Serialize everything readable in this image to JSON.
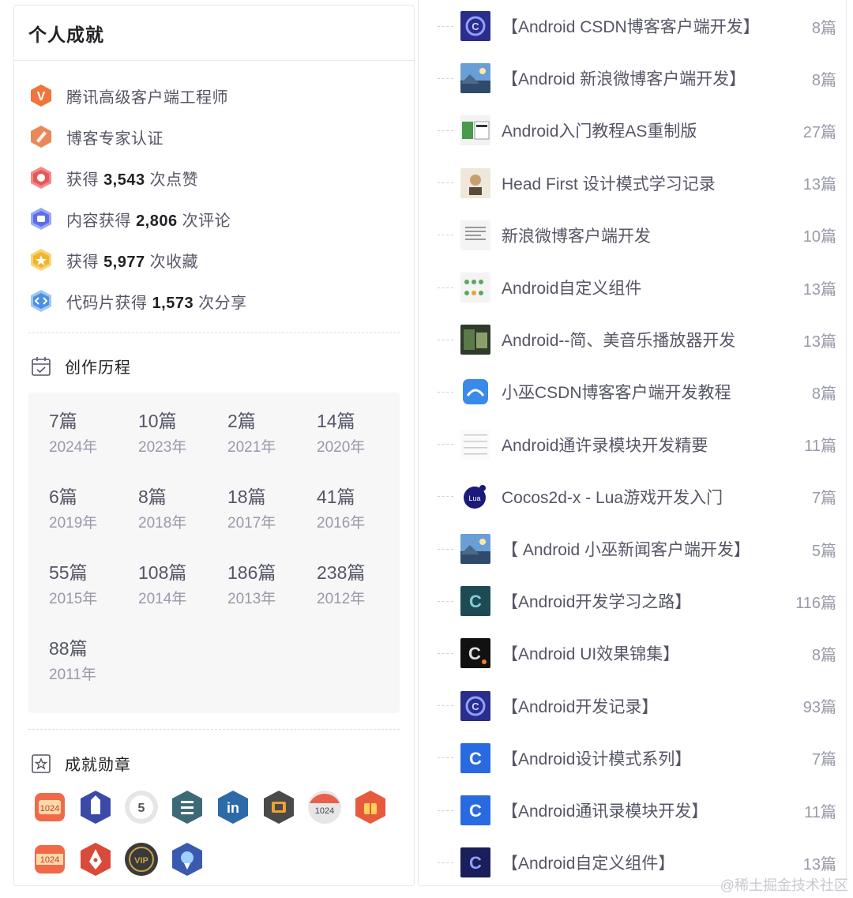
{
  "profile": {
    "title": "个人成就",
    "achievements": [
      {
        "icon": "v-badge-icon",
        "pre": "腾讯高级客户端工程师",
        "num": "",
        "post": ""
      },
      {
        "icon": "expert-badge-icon",
        "pre": "博客专家认证",
        "num": "",
        "post": ""
      },
      {
        "icon": "like-badge-icon",
        "pre": "获得 ",
        "num": "3,543",
        "post": " 次点赞"
      },
      {
        "icon": "comment-badge-icon",
        "pre": "内容获得 ",
        "num": "2,806",
        "post": " 次评论"
      },
      {
        "icon": "favorite-badge-icon",
        "pre": "获得 ",
        "num": "5,977",
        "post": " 次收藏"
      },
      {
        "icon": "code-badge-icon",
        "pre": "代码片获得 ",
        "num": "1,573",
        "post": " 次分享"
      }
    ]
  },
  "history": {
    "title": "创作历程",
    "items": [
      {
        "count": "7篇",
        "year": "2024年"
      },
      {
        "count": "10篇",
        "year": "2023年"
      },
      {
        "count": "2篇",
        "year": "2021年"
      },
      {
        "count": "14篇",
        "year": "2020年"
      },
      {
        "count": "6篇",
        "year": "2019年"
      },
      {
        "count": "8篇",
        "year": "2018年"
      },
      {
        "count": "18篇",
        "year": "2017年"
      },
      {
        "count": "41篇",
        "year": "2016年"
      },
      {
        "count": "55篇",
        "year": "2015年"
      },
      {
        "count": "108篇",
        "year": "2014年"
      },
      {
        "count": "186篇",
        "year": "2013年"
      },
      {
        "count": "238篇",
        "year": "2012年"
      },
      {
        "count": "88篇",
        "year": "2011年"
      }
    ]
  },
  "medals": {
    "title": "成就勋章",
    "items": [
      {
        "icon": "medal-1024-icon",
        "color": "#e8604c"
      },
      {
        "icon": "medal-castle-icon",
        "color": "#3b4aa8"
      },
      {
        "icon": "medal-5-year-icon",
        "color": "#e6e6e6"
      },
      {
        "icon": "medal-list-icon",
        "color": "#3e6a78"
      },
      {
        "icon": "medal-linkedin-icon",
        "color": "#2e6aa8"
      },
      {
        "icon": "medal-bracket-icon",
        "color": "#4a4a4a"
      },
      {
        "icon": "medal-1024-gray-icon",
        "color": "#d8d8d8"
      },
      {
        "icon": "medal-gift-icon",
        "color": "#e85a3c"
      },
      {
        "icon": "medal-1024-ribbon-icon",
        "color": "#e8604c"
      },
      {
        "icon": "medal-pen-icon",
        "color": "#d94a3a"
      },
      {
        "icon": "medal-vip-icon",
        "color": "#3a3a3a"
      },
      {
        "icon": "medal-rocket-icon",
        "color": "#3a5ab0"
      }
    ]
  },
  "columns": [
    {
      "name": "【Android CSDN博客客户端开发】",
      "count": "8篇",
      "thumb": "csdn-logo-thumb"
    },
    {
      "name": "【Android 新浪微博客户端开发】",
      "count": "8篇",
      "thumb": "landscape-thumb"
    },
    {
      "name": "Android入门教程AS重制版",
      "count": "27篇",
      "thumb": "ui-screens-thumb"
    },
    {
      "name": "Head First 设计模式学习记录",
      "count": "13篇",
      "thumb": "book-cover-thumb"
    },
    {
      "name": "新浪微博客户端开发",
      "count": "10篇",
      "thumb": "document-thumb"
    },
    {
      "name": "Android自定义组件",
      "count": "13篇",
      "thumb": "components-thumb"
    },
    {
      "name": "Android--简、美音乐播放器开发",
      "count": "13篇",
      "thumb": "music-thumb"
    },
    {
      "name": "小巫CSDN博客客户端开发教程",
      "count": "8篇",
      "thumb": "blue-app-thumb"
    },
    {
      "name": "Android通许录模块开发精要",
      "count": "11篇",
      "thumb": "list-doc-thumb"
    },
    {
      "name": "Cocos2d-x - Lua游戏开发入门",
      "count": "7篇",
      "thumb": "lua-logo-thumb"
    },
    {
      "name": "【 Android 小巫新闻客户端开发】",
      "count": "5篇",
      "thumb": "landscape-thumb-2"
    },
    {
      "name": "【Android开发学习之路】",
      "count": "116篇",
      "thumb": "teal-c-thumb"
    },
    {
      "name": "【Android UI效果锦集】",
      "count": "8篇",
      "thumb": "dark-c-thumb"
    },
    {
      "name": "【Android开发记录】",
      "count": "93篇",
      "thumb": "csdn-logo-thumb-2"
    },
    {
      "name": "【Android设计模式系列】",
      "count": "7篇",
      "thumb": "blue-c-thumb"
    },
    {
      "name": "【Android通讯录模块开发】",
      "count": "11篇",
      "thumb": "blue-c-thumb-2"
    },
    {
      "name": "【Android自定义组件】",
      "count": "13篇",
      "thumb": "navy-c-thumb"
    }
  ],
  "watermark": "@稀土掘金技术社区"
}
